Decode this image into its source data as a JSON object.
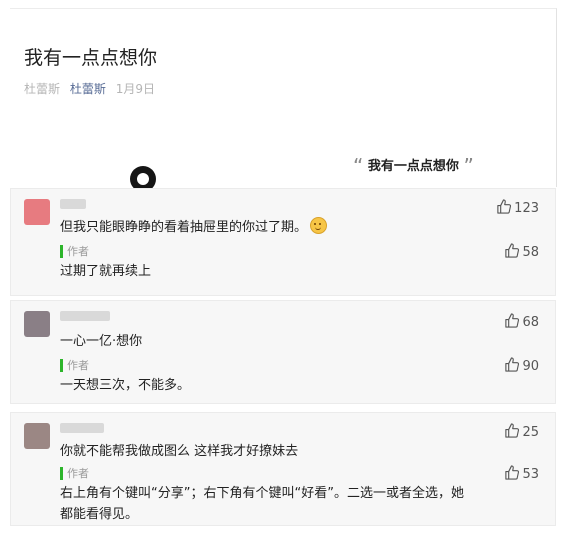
{
  "article": {
    "title": "我有一点点想你",
    "meta_source": "杜蕾斯",
    "meta_author": "杜蕾斯",
    "meta_date": "1月9日",
    "quote_title": "我有一点点想你",
    "quote_open": "“",
    "quote_close": "”"
  },
  "comments": [
    {
      "text": "但我只能眼睁睁的看着抽屉里的你过了期。",
      "likes": "123",
      "reply": {
        "tag": "作者",
        "text": "过期了就再续上",
        "likes": "58"
      }
    },
    {
      "text": "一心一亿·想你",
      "likes": "68",
      "reply": {
        "tag": "作者",
        "text": "一天想三次，不能多。",
        "likes": "90"
      }
    },
    {
      "text": "你就不能帮我做成图么 这样我才好撩妹去",
      "likes": "25",
      "reply": {
        "tag": "作者",
        "text_line1": "右上角有个键叫“分享”；右下角有个键叫“好看”。二选一或者全选，她",
        "text_line2": "都能看得见。",
        "likes": "53"
      }
    }
  ],
  "icons": {
    "like": "thumbs-up-icon",
    "emoji": "smiling-face-emoji"
  },
  "colors": {
    "author_bar": "#2db52b",
    "link": "#576b95",
    "panel": "#f7f7f7"
  }
}
